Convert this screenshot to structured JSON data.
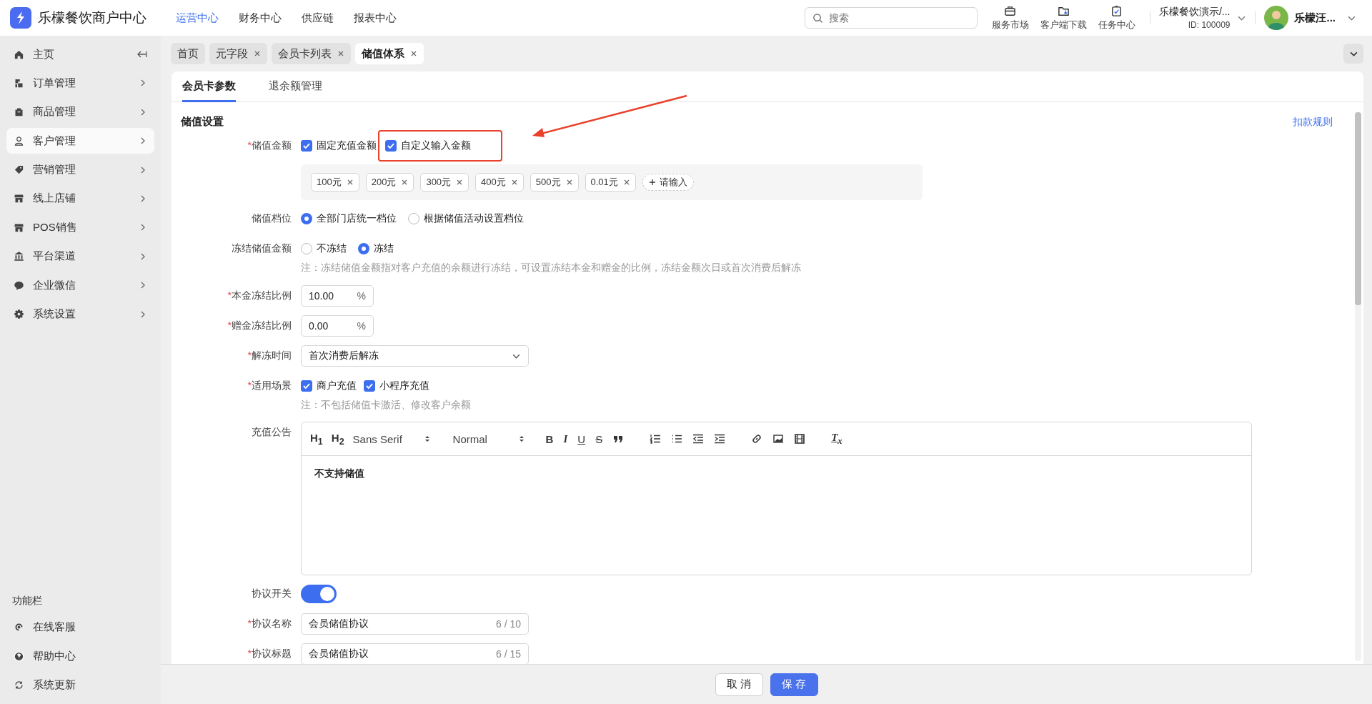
{
  "app": {
    "logo_text": "乐檬餐饮商户中心"
  },
  "top_nav": [
    {
      "label": "运营中心",
      "selected": true
    },
    {
      "label": "财务中心",
      "selected": false
    },
    {
      "label": "供应链",
      "selected": false
    },
    {
      "label": "报表中心",
      "selected": false
    }
  ],
  "search": {
    "placeholder": "搜索"
  },
  "tools": [
    {
      "label": "服务市场"
    },
    {
      "label": "客户端下载"
    },
    {
      "label": "任务中心"
    }
  ],
  "account": {
    "name": "乐檬餐饮演示/...",
    "id": "ID: 100009"
  },
  "user": {
    "name": "乐檬汪..."
  },
  "sidebar": {
    "items": [
      {
        "label": "主页",
        "selected": false,
        "expandable": false
      },
      {
        "label": "订单管理",
        "selected": false,
        "expandable": true
      },
      {
        "label": "商品管理",
        "selected": false,
        "expandable": true
      },
      {
        "label": "客户管理",
        "selected": true,
        "expandable": true
      },
      {
        "label": "营销管理",
        "selected": false,
        "expandable": true
      },
      {
        "label": "线上店铺",
        "selected": false,
        "expandable": true
      },
      {
        "label": "POS销售",
        "selected": false,
        "expandable": true
      },
      {
        "label": "平台渠道",
        "selected": false,
        "expandable": true
      },
      {
        "label": "企业微信",
        "selected": false,
        "expandable": true
      },
      {
        "label": "系统设置",
        "selected": false,
        "expandable": true
      }
    ],
    "section_title": "功能栏",
    "footer_items": [
      "在线客服",
      "帮助中心",
      "系统更新"
    ]
  },
  "page_tabs": [
    {
      "label": "首页",
      "closable": false,
      "selected": false
    },
    {
      "label": "元字段",
      "closable": true,
      "selected": false
    },
    {
      "label": "会员卡列表",
      "closable": true,
      "selected": false
    },
    {
      "label": "储值体系",
      "closable": true,
      "selected": true
    }
  ],
  "sub_tabs": [
    {
      "label": "会员卡参数",
      "selected": true
    },
    {
      "label": "退余额管理",
      "selected": false
    }
  ],
  "form": {
    "section_title": "储值设置",
    "link": "扣款规则",
    "required_mark": "*",
    "rows": [
      {
        "kind": "checks",
        "label": "储值金额",
        "required": true,
        "options": [
          {
            "label": "固定充值金额",
            "checked": true,
            "annotated": false
          },
          {
            "label": "自定义输入金额",
            "checked": true,
            "annotated": true
          }
        ]
      },
      {
        "kind": "tags",
        "tags": [
          "100元",
          "200元",
          "300元",
          "400元",
          "500元",
          "0.01元"
        ],
        "add_label": "请输入"
      },
      {
        "kind": "radios",
        "label": "储值档位",
        "required": false,
        "options": [
          {
            "label": "全部门店统一档位",
            "selected": true
          },
          {
            "label": "根据储值活动设置档位",
            "selected": false
          }
        ]
      },
      {
        "kind": "radios",
        "label": "冻结储值金额",
        "required": false,
        "options": [
          {
            "label": "不冻结",
            "selected": false
          },
          {
            "label": "冻结",
            "selected": true
          }
        ]
      },
      {
        "kind": "note",
        "text": "注：冻结储值金额指对客户充值的余额进行冻结，可设置冻结本金和赠金的比例，冻结金额次日或首次消费后解冻"
      },
      {
        "kind": "number",
        "label": "本金冻结比例",
        "required": true,
        "value": "10.00",
        "suffix": "%"
      },
      {
        "kind": "number",
        "label": "赠金冻结比例",
        "required": true,
        "value": "0.00",
        "suffix": "%"
      },
      {
        "kind": "select",
        "label": "解冻时间",
        "required": true,
        "value": "首次消费后解冻"
      },
      {
        "kind": "checks",
        "label": "适用场景",
        "required": true,
        "options": [
          {
            "label": "商户充值",
            "checked": true,
            "annotated": false
          },
          {
            "label": "小程序充值",
            "checked": true,
            "annotated": false
          }
        ]
      },
      {
        "kind": "note",
        "text": "注：不包括储值卡激活、修改客户余额"
      },
      {
        "kind": "editor",
        "label": "充值公告",
        "required": false,
        "headings": [
          "H$_{1}$",
          "H$_{2}$"
        ],
        "font": "Sans Serif",
        "size": "Normal",
        "marks": [
          "B",
          "I",
          "U",
          "S"
        ],
        "clear": "T$_{x}$",
        "content": "不支持储值"
      },
      {
        "kind": "switch",
        "label": "协议开关",
        "required": false,
        "on": true
      },
      {
        "kind": "text",
        "label": "协议名称",
        "required": true,
        "value": "会员储值协议",
        "count": "6 / 10"
      },
      {
        "kind": "text",
        "label": "协议标题",
        "required": true,
        "value": "会员储值协议",
        "count": "6 / 15"
      }
    ]
  },
  "actions": [
    {
      "label": "取 消",
      "kind": "default"
    },
    {
      "label": "保 存",
      "kind": "primary"
    }
  ]
}
